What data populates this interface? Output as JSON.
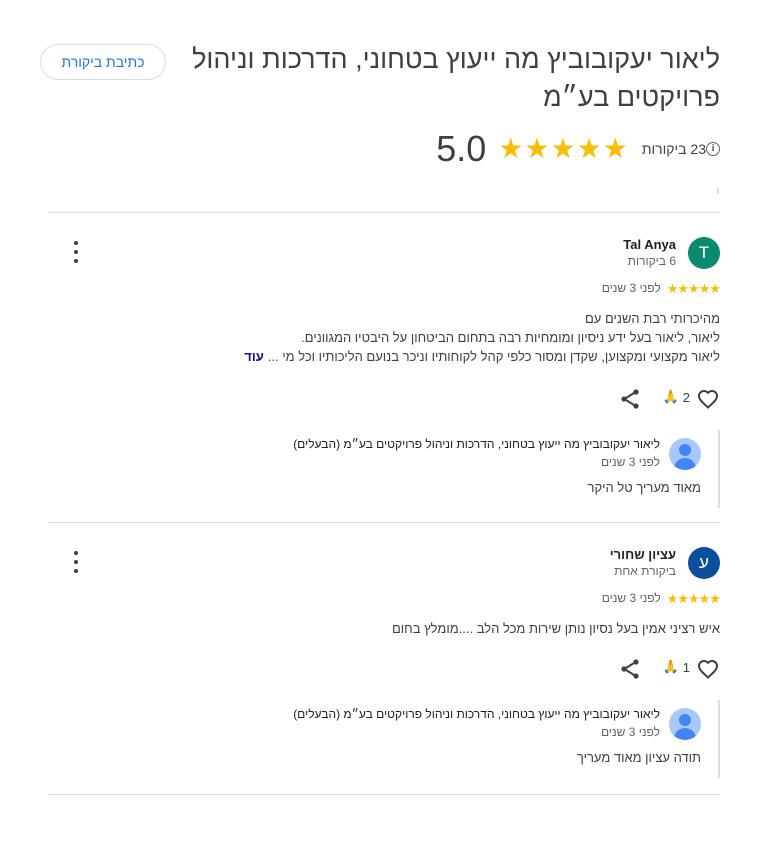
{
  "business": {
    "title": "ליאור יעקובוביץ מה ייעוץ בטחוני, הדרכות וניהול פרויקטים בע״מ",
    "write_review_label": "כתיבת ביקורת",
    "rating_value": "5.0",
    "stars": 5,
    "review_count_text": "23 ביקורות",
    "info_icon": "i"
  },
  "reviews": [
    {
      "avatar_letter": "T",
      "avatar_color": "#0a8a6e",
      "name": "Tal Anya",
      "sub": "6 ביקורות",
      "stars": 5,
      "time": "לפני 3 שנים",
      "text_lines": [
        "מהיכרותי רבת השנים עם",
        "ליאור, ליאור בעל ידע ניסיון ומומחיות רבה בתחום הביטחון על היבטיו המגוונים.",
        "ליאור מקצועי ומקצוען, שקדן ומסור כלפי קהל לקוחותיו וניכר בנועם הליכותיו וכל מי ..."
      ],
      "more_label": "עוד",
      "reaction_count": "2",
      "reaction_emoji": "🙏",
      "owner": {
        "name": "ליאור יעקובוביץ מה ייעוץ בטחוני, הדרכות וניהול פרויקטים בע״מ (הבעלים)",
        "time": "לפני 3 שנים",
        "text": "מאוד מעריך טל היקר"
      }
    },
    {
      "avatar_letter": "ע",
      "avatar_color": "#0b4f9c",
      "name": "עציון שחורי",
      "sub": "ביקורת אחת",
      "stars": 5,
      "time": "לפני 3 שנים",
      "text_lines": [
        "איש רציני אמין בעל נסיון נותן שירות מכל הלב ....מומלץ בחום"
      ],
      "reaction_count": "1",
      "reaction_emoji": "🙏",
      "owner": {
        "name": "ליאור יעקובוביץ מה ייעוץ בטחוני, הדרכות וניהול פרויקטים בע״מ (הבעלים)",
        "time": "לפני 3 שנים",
        "text": "תודה עציון מאוד מעריך"
      }
    }
  ],
  "colors": {
    "star": "#fbbc04",
    "link_blue": "#1a73e8",
    "divider": "#dadce0"
  }
}
